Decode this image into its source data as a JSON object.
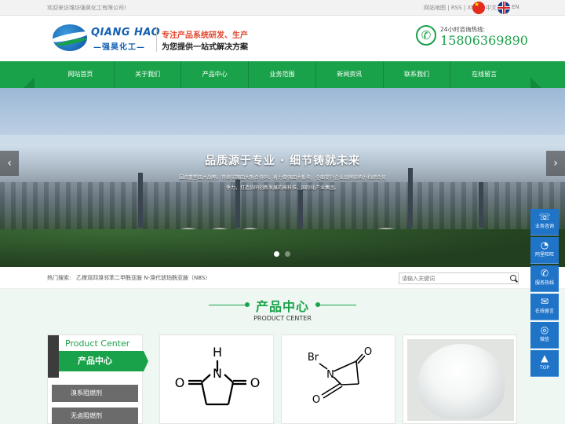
{
  "topbar": {
    "welcome": "欢迎来访潍坊强昊化工有限公司!",
    "links": [
      "网站地图",
      "RSS",
      "XML"
    ],
    "lang_cn": "中文",
    "lang_en": "EN"
  },
  "header": {
    "logo_en": "QIANG HAO",
    "logo_cn": "—强昊化工—",
    "slogan1": "专注产品系统研发、生产",
    "slogan2": "为您提供一站式解决方案",
    "hotline_label": "24小时咨询热线:",
    "hotline_number": "15806369890"
  },
  "nav": {
    "items": [
      {
        "label": "网站首页"
      },
      {
        "label": "关于我们"
      },
      {
        "label": "产品中心"
      },
      {
        "label": "业务范围"
      },
      {
        "label": "新闻资讯"
      },
      {
        "label": "联系我们"
      },
      {
        "label": "在线留言"
      }
    ]
  },
  "banner": {
    "title": "品质源于专业 · 细节铸就未来",
    "desc": "围绕重塑四大战略、持续实施四大融合协同、着力做强四大板块，全面提升企业品牌影响力和综合竞争力，打造协同创新发展的高科技、国际化产业集团。",
    "prev_icon": "‹",
    "next_icon": "›",
    "slide_count": 2,
    "active_slide": 1
  },
  "search": {
    "hot_label": "热门搜索:",
    "keywords": "乙撑双四溴邻苯二甲酰亚胺  N-溴代琥珀酰亚胺（NBS）",
    "placeholder": "请输入关键词"
  },
  "product_center": {
    "title": "产品中心",
    "subtitle": "PRODUCT CENTER",
    "category_en": "Product Center",
    "category_title": "产品中心",
    "categories": [
      "溴系阻燃剂",
      "无卤阻燃剂"
    ],
    "products": [
      {
        "atoms": {
          "n": "N",
          "h": "H",
          "o1": "O",
          "o2": "O"
        }
      },
      {
        "atoms": {
          "br": "Br",
          "n": "N",
          "o1": "O",
          "o2": "O"
        }
      },
      {
        "image": "white-powder"
      }
    ]
  },
  "side_float": {
    "items": [
      {
        "icon": "headset-icon",
        "glyph": "☏",
        "label": "业务咨询"
      },
      {
        "icon": "wangwang-icon",
        "glyph": "◔",
        "label": "阿里旺旺"
      },
      {
        "icon": "phone-icon",
        "glyph": "✆",
        "label": "服务热线"
      },
      {
        "icon": "message-icon",
        "glyph": "✉",
        "label": "在线留言"
      },
      {
        "icon": "wechat-icon",
        "glyph": "◎",
        "label": "微信"
      },
      {
        "icon": "top-icon",
        "glyph": "▲",
        "label": "TOP"
      }
    ]
  },
  "colors": {
    "brand_green": "#19a24a",
    "brand_blue": "#1560b0",
    "float_blue": "#1f74c8",
    "accent_red": "#e0452c"
  }
}
